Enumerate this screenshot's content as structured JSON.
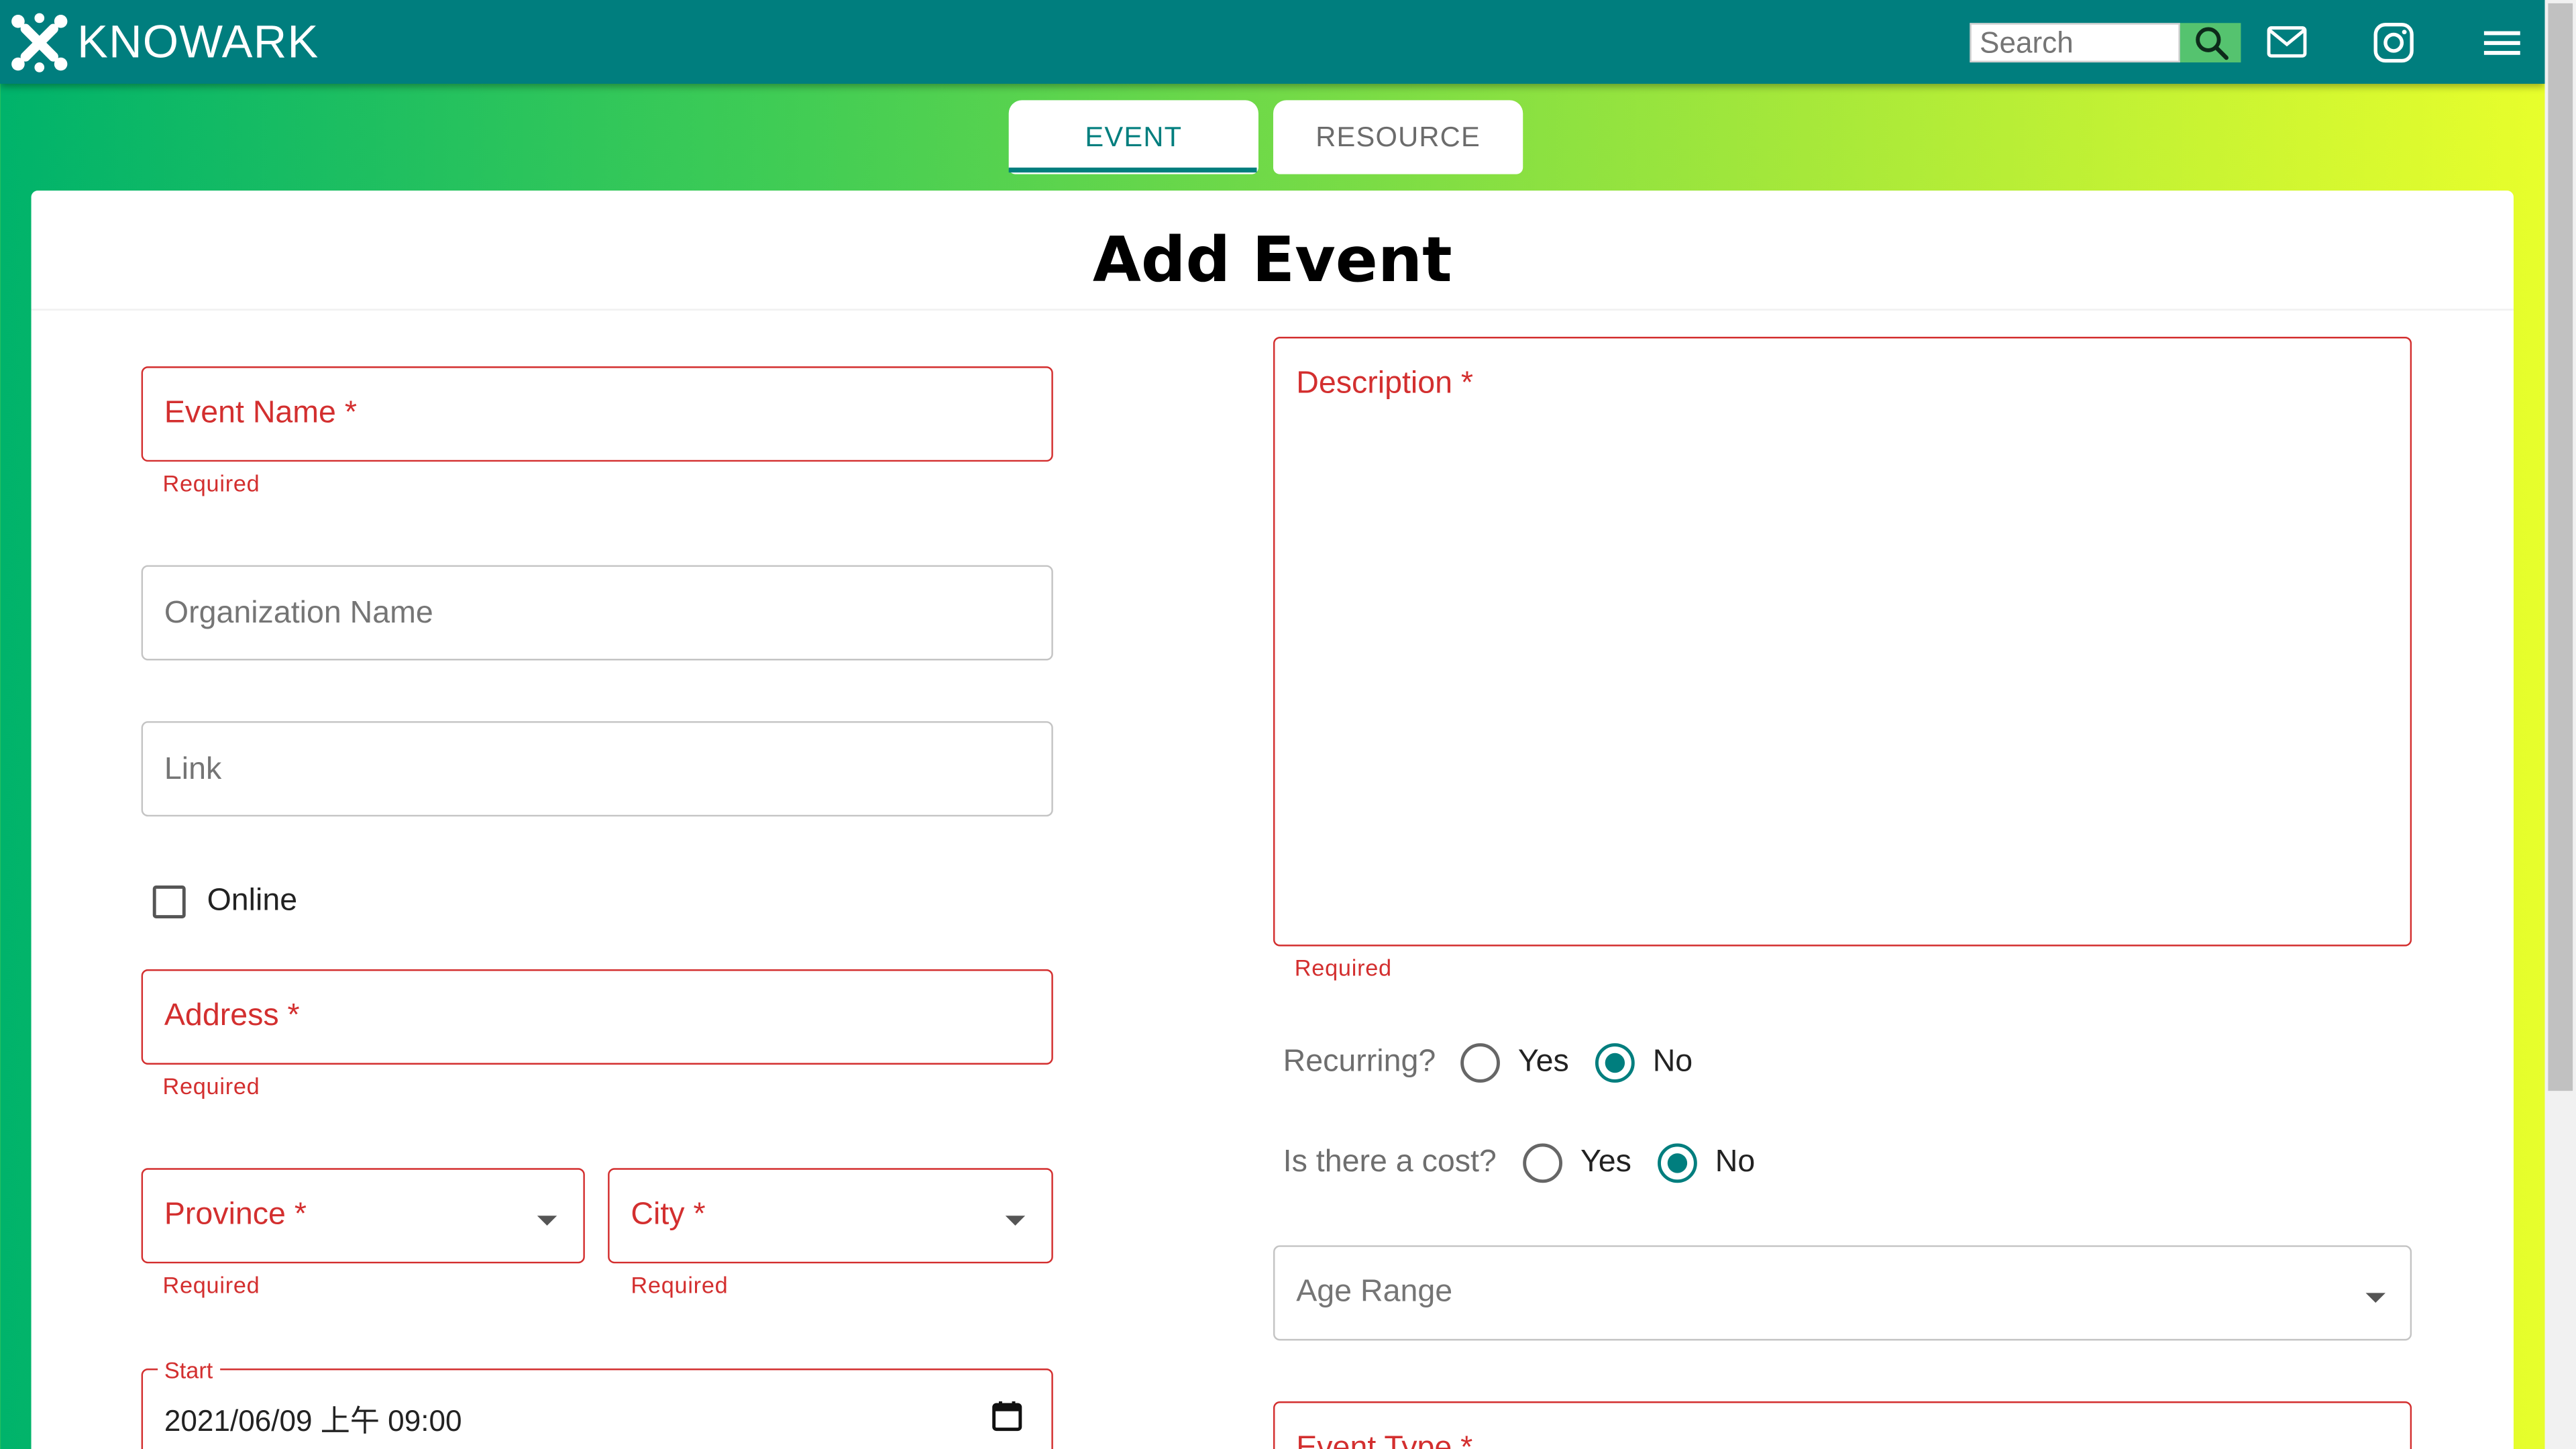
{
  "header": {
    "brand": "KNOWARK",
    "search_placeholder": "Search",
    "icons": [
      "logo-icon",
      "search-icon",
      "mail-icon",
      "instagram-icon",
      "menu-icon"
    ]
  },
  "tabs": [
    {
      "label": "EVENT",
      "active": true
    },
    {
      "label": "RESOURCE",
      "active": false
    }
  ],
  "form": {
    "title": "Add Event",
    "event_name": {
      "label": "Event Name *",
      "helper": "Required"
    },
    "organization_name": {
      "label": "Organization Name"
    },
    "link": {
      "label": "Link"
    },
    "online": {
      "label": "Online",
      "checked": false
    },
    "address": {
      "label": "Address *",
      "helper": "Required"
    },
    "province": {
      "label": "Province *",
      "helper": "Required"
    },
    "city": {
      "label": "City *",
      "helper": "Required"
    },
    "start": {
      "label": "Start",
      "value": "2021/06/09 上午 09:00"
    },
    "description": {
      "label": "Description *",
      "helper": "Required"
    },
    "recurring": {
      "label": "Recurring?",
      "yes": "Yes",
      "no": "No",
      "selected": "No"
    },
    "cost": {
      "label": "Is there a cost?",
      "yes": "Yes",
      "no": "No",
      "selected": "No"
    },
    "age_range": {
      "label": "Age Range"
    },
    "event_type": {
      "label": "Event Type *"
    }
  },
  "colors": {
    "primary": "#007e7e",
    "error": "#d32f2f",
    "search_button": "#55c36f"
  }
}
